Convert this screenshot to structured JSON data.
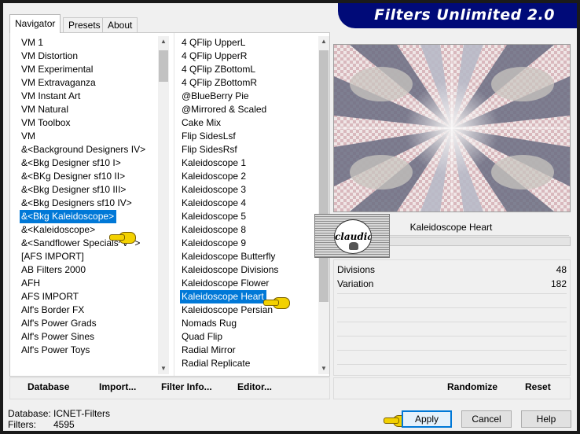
{
  "window": {
    "title": "Filters Unlimited 2.0"
  },
  "tabs": [
    {
      "label": "Navigator",
      "active": true
    },
    {
      "label": "Presets",
      "active": false
    },
    {
      "label": "About",
      "active": false
    }
  ],
  "categories": [
    "VM 1",
    "VM Distortion",
    "VM Experimental",
    "VM Extravaganza",
    "VM Instant Art",
    "VM Natural",
    "VM Toolbox",
    "VM",
    "&<Background Designers IV>",
    "&<Bkg Designer sf10 I>",
    "&<BKg Designer sf10 II>",
    "&<Bkg Designer sf10 III>",
    "&<Bkg Designers sf10 IV>",
    "&<Bkg Kaleidoscope>",
    "&<Kaleidoscope>",
    "&<Sandflower Specials^v^ >",
    "[AFS IMPORT]",
    "AB Filters 2000",
    "AFH",
    "AFS IMPORT",
    "Alf's Border FX",
    "Alf's Power Grads",
    "Alf's Power Sines",
    "Alf's Power Toys"
  ],
  "filters": [
    "4 QFlip UpperL",
    "4 QFlip UpperR",
    "4 QFlip ZBottomL",
    "4 QFlip ZBottomR",
    "@BlueBerry Pie",
    "@Mirrored & Scaled",
    "Cake Mix",
    "Flip SidesLsf",
    "Flip SidesRsf",
    "Kaleidoscope 1",
    "Kaleidoscope 2",
    "Kaleidoscope 3",
    "Kaleidoscope 4",
    "Kaleidoscope 5",
    "Kaleidoscope 8",
    "Kaleidoscope 9",
    "Kaleidoscope Butterfly",
    "Kaleidoscope Divisions",
    "Kaleidoscope Flower",
    "Kaleidoscope Heart",
    "Kaleidoscope Persian",
    "Nomads Rug",
    "Quad Flip",
    "Radial Mirror",
    "Radial Replicate"
  ],
  "selected_category_index": 13,
  "selected_filter_index": 19,
  "filter_name": "Kaleidoscope Heart",
  "watermark": "claudia",
  "params": [
    {
      "label": "Divisions",
      "value": "48"
    },
    {
      "label": "Variation",
      "value": "182"
    }
  ],
  "links": {
    "database": "Database",
    "import": "Import...",
    "filter_info": "Filter Info...",
    "editor": "Editor...",
    "randomize": "Randomize",
    "reset": "Reset"
  },
  "status": {
    "database_label": "Database:",
    "database_value": "ICNET-Filters",
    "filters_label": "Filters:",
    "filters_value": "4595"
  },
  "buttons": {
    "apply": "Apply",
    "cancel": "Cancel",
    "help": "Help"
  },
  "colors": {
    "banner": "#000a78",
    "selection": "#0078d7",
    "pointer": "#f3d100"
  }
}
